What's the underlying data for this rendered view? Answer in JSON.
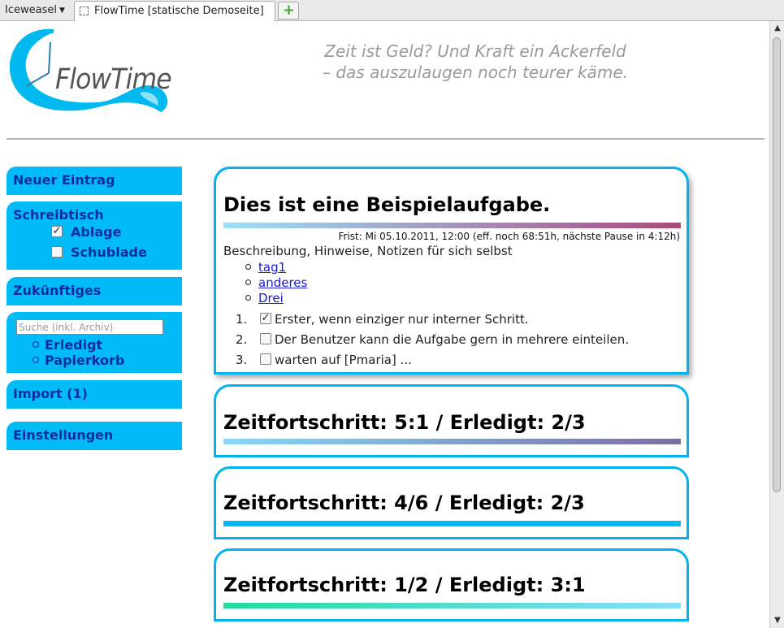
{
  "browser": {
    "app_menu": "Iceweasel",
    "tab_title": "FlowTime [statische Demoseite]",
    "new_tab": "+"
  },
  "header": {
    "logo_text": "FlowTime",
    "slogan_line1": "Zeit ist Geld? Und Kraft ein Ackerfeld",
    "slogan_line2": "– das auszulaugen noch teurer käme."
  },
  "sidebar": {
    "new_entry": "Neuer Eintrag",
    "desk": "Schreibtisch",
    "desk_items": [
      {
        "label": "Ablage",
        "checked": true
      },
      {
        "label": "Schublade",
        "checked": false
      }
    ],
    "future": "Zukünftiges",
    "search_placeholder": "Suche (inkl. Archiv)",
    "archive_items": [
      "Erledigt",
      "Papierkorb"
    ],
    "import": "Import (1)",
    "settings": "Einstellungen"
  },
  "tasks": [
    {
      "title": "Dies ist eine Beispielaufgabe.",
      "deadline": "Frist: Mi 05.10.2011, 12:00 (eff. noch 68:51h, nächste Pause in 4:12h)",
      "description": "Beschreibung, Hinweise, Notizen für sich selbst",
      "tags": [
        "tag1",
        "anderes",
        "Drei"
      ],
      "steps": [
        {
          "num": "1.",
          "text": "Erster, wenn einziger nur interner Schritt.",
          "checked": true
        },
        {
          "num": "2.",
          "text": "Der Benutzer kann die Aufgabe gern in mehrere einteilen.",
          "checked": false
        },
        {
          "num": "3.",
          "text": "warten auf [Pmaria] ...",
          "checked": false
        }
      ],
      "bar_colors": [
        "#9fe0f7",
        "#a74b7a"
      ]
    },
    {
      "title": "Zeitfortschritt: 5:1 / Erledigt: 2/3",
      "bar_colors": [
        "#8ad8f6",
        "#7c6e9f"
      ]
    },
    {
      "title": "Zeitfortschritt: 4/6 / Erledigt: 2/3",
      "bar_colors": [
        "#00bbf5",
        "#00bbf5"
      ]
    },
    {
      "title": "Zeitfortschritt: 1/2 / Erledigt: 3:1",
      "bar_colors": [
        "#1fdc9e",
        "#87dffa"
      ]
    }
  ],
  "colors": {
    "accent": "#00bbf5",
    "nav_text": "#0b2f9e",
    "card_border": "#00b3f0"
  },
  "icons": {
    "favicon": "dashed-square-icon",
    "new_tab": "plus-icon",
    "logo": "water-swirl-clock-icon"
  }
}
